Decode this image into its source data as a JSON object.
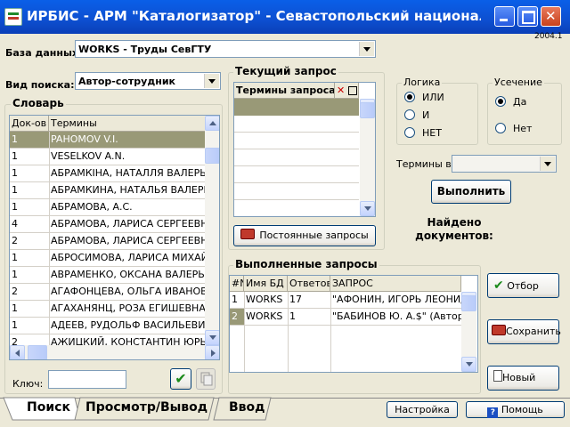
{
  "window": {
    "title": "ИРБИС - АРМ \"Каталогизатор\" - Севастопольский национальн...",
    "version": "2004.1"
  },
  "db": {
    "label": "База данных:",
    "value": "WORKS - Труды СевГТУ"
  },
  "search_type": {
    "label": "Вид поиска:",
    "value": "Автор-сотрудник"
  },
  "dictionary": {
    "title": "Словарь",
    "columns": [
      "Док-ов",
      "Термины"
    ],
    "rows": [
      {
        "count": "1",
        "term": "PAHOMOV V.I."
      },
      {
        "count": "1",
        "term": "VESELKOV A.N."
      },
      {
        "count": "1",
        "term": "АБРАМКІНА, НАТАЛЛЯ ВАЛЕРЬЕВ"
      },
      {
        "count": "1",
        "term": "АБРАМКИНА, НАТАЛЬЯ ВАЛЕРЬЕВ"
      },
      {
        "count": "1",
        "term": "АБРАМОВА, А.С."
      },
      {
        "count": "4",
        "term": "АБРАМОВА, ЛАРИСА СЕРГЕЕВНА"
      },
      {
        "count": "2",
        "term": "АБРАМОВА, ЛАРИСА СЕРГЕЕВНА"
      },
      {
        "count": "1",
        "term": "АБРОСИМОВА, ЛАРИСА МИХАЙ"
      },
      {
        "count": "1",
        "term": "АВРАМЕНКО, ОКСАНА ВАЛЕРЬЕЕ"
      },
      {
        "count": "2",
        "term": "АГАФОНЦЕВА, ОЛЬГА ИВАНОВН"
      },
      {
        "count": "1",
        "term": "АГАХАНЯНЦ, РОЗА ЕГИШЕВНА ("
      },
      {
        "count": "1",
        "term": "АДЕЕВ, РУДОЛЬФ ВАСИЛЬЕВИЧ"
      },
      {
        "count": "2",
        "term": "АЖИЦКИЙ, КОНСТАНТИН ЮРЬЕ"
      }
    ],
    "key_label": "Ключ:"
  },
  "current_query": {
    "title": "Текущий запрос",
    "column": "Термины запроса",
    "permanent_button": "Постоянные запросы"
  },
  "logic": {
    "title": "Логика",
    "options": [
      "ИЛИ",
      "И",
      "НЕТ"
    ]
  },
  "truncation": {
    "title": "Усечение",
    "options": [
      "Да",
      "Нет"
    ]
  },
  "terms_in_label": "Термины в",
  "execute_button": "Выполнить",
  "found_label": "Найдено документов:",
  "executed": {
    "title": "Выполненные запросы",
    "columns": [
      "#N",
      "Имя БД",
      "Ответов",
      "ЗАПРОС"
    ],
    "rows": [
      {
        "n": "1",
        "db": "WORKS",
        "answers": "17",
        "query": "\"АФОНИН, ИГОРЬ ЛЕОНИД"
      },
      {
        "n": "2",
        "db": "WORKS",
        "answers": "1",
        "query": "\"БАБИНОВ Ю. А.$\" (Автор-"
      }
    ]
  },
  "side_buttons": {
    "select": "Отбор",
    "save": "Сохранить",
    "new": "Новый"
  },
  "tabs": [
    "Поиск",
    "Просмотр/Вывод",
    "Ввод"
  ],
  "bottom": {
    "settings": "Настройка",
    "help": "Помощь"
  }
}
